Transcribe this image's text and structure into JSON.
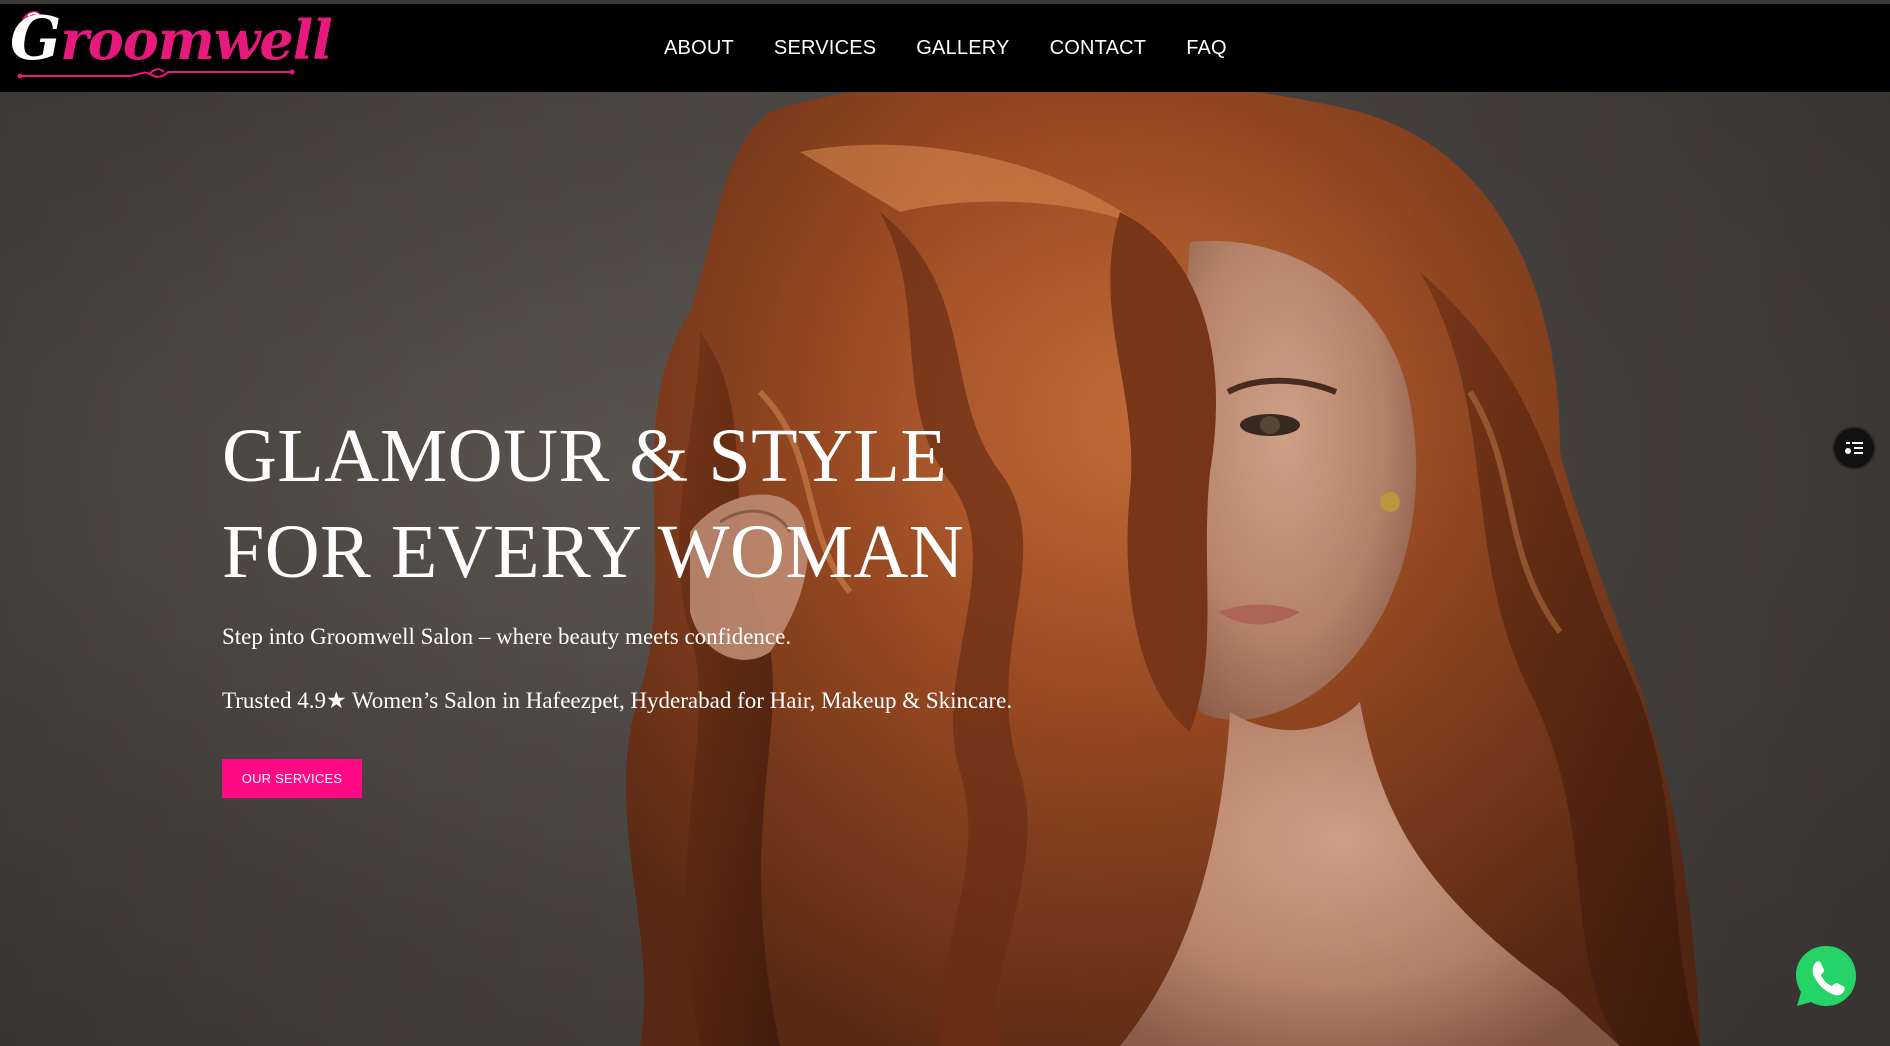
{
  "brand": {
    "name": "Groomwell",
    "initial": "G",
    "rest": "roomwell",
    "accent_color": "#e8197d"
  },
  "nav": {
    "items": [
      {
        "label": "ABOUT"
      },
      {
        "label": "SERVICES"
      },
      {
        "label": "GALLERY"
      },
      {
        "label": "CONTACT"
      },
      {
        "label": "FAQ"
      }
    ]
  },
  "hero": {
    "headline_line1": "GLAMOUR & STYLE",
    "headline_line2": "FOR EVERY WOMAN",
    "tagline": "Step into Groomwell Salon – where beauty meets confidence.",
    "rating_line": "Trusted 4.9★ Women’s Salon in Hafeezpet, Hyderabad for Hair, Makeup & Skincare.",
    "cta_label": "OUR SERVICES",
    "cta_color": "#ff0a84",
    "image": "woman-with-long-auburn-wavy-hair"
  },
  "floating": {
    "menu_icon": "list-menu-icon",
    "whatsapp_icon": "whatsapp-icon",
    "whatsapp_color": "#25d366"
  }
}
